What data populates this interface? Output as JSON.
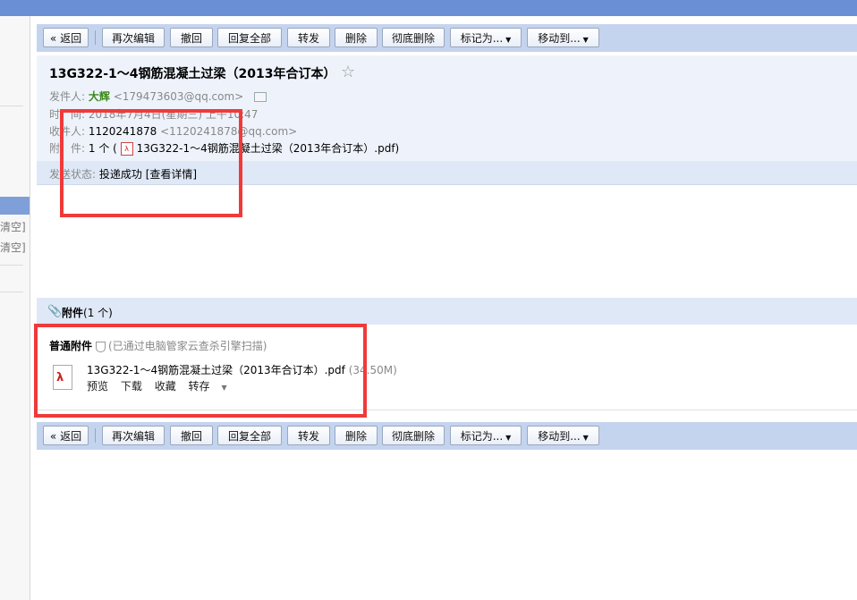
{
  "left_sidebar": {
    "clear_labels": [
      "清空]",
      "清空]"
    ]
  },
  "toolbar": {
    "back": "« 返回",
    "buttons": [
      "再次编辑",
      "撤回",
      "回复全部",
      "转发",
      "删除",
      "彻底删除"
    ],
    "mark_as": "标记为...",
    "move_to": "移动到..."
  },
  "email": {
    "subject": "13G322-1～4钢筋混凝土过梁（2013年合订本）",
    "star": "☆",
    "from_label": "发件人:",
    "from_name": "大辉",
    "from_email": "<179473603@qq.com>",
    "time_label": "时　间:",
    "time_value": "2018年7月4日(星期三) 上午10:47",
    "to_label": "收件人:",
    "to_name": "1120241878",
    "to_email": "<1120241878@qq.com>",
    "attach_label": "附　件:",
    "attach_count": "1 个 (",
    "attach_file": "13G322-1～4钢筋混凝土过梁（2013年合订本）.pdf)",
    "status_label": "发送状态:",
    "status_value": "投递成功",
    "status_link": "[查看详情]"
  },
  "attachments": {
    "title": "附件",
    "count": "(1 个)",
    "type_label": "普通附件",
    "scan_note": "(已通过电脑管家云查杀引擎扫描)",
    "file_name": "13G322-1～4钢筋混凝土过梁（2013年合订本）.pdf",
    "file_size": "(34.50M)",
    "actions": [
      "预览",
      "下载",
      "收藏",
      "转存"
    ]
  },
  "icons": {
    "star": "star-icon",
    "contact_card": "contact-card-icon",
    "pdf": "pdf-icon",
    "paperclip": "paperclip-icon",
    "shield": "shield-icon"
  },
  "colors": {
    "toolbar_bg": "#c5d4ee",
    "header_bg": "#eef3fb",
    "highlight_box": "#f03a3a",
    "sender_name": "#3a8a1b"
  }
}
